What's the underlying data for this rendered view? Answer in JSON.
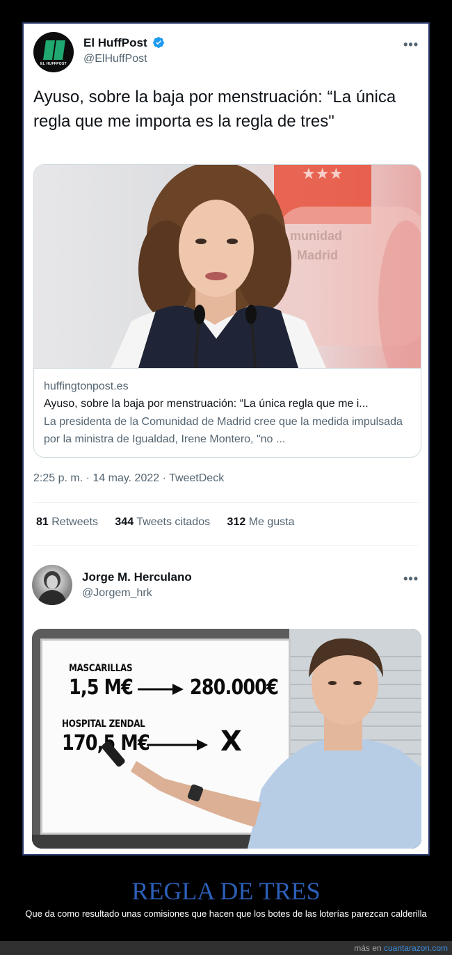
{
  "tweet": {
    "author_name": "El HuffPost",
    "author_handle": "@ElHuffPost",
    "avatar_text": "EL HUFFPOST",
    "more_label": "•••",
    "text": "Ayuso, sobre la baja por menstruación: “La única regla que me importa es la regla de tres\"",
    "card": {
      "domain": "huffingtonpost.es",
      "title": "Ayuso, sobre la baja por menstruación: “La única regla que me i...",
      "description": "La presidenta de la Comunidad de Madrid cree que la medida impulsada por la ministra de Igualdad, Irene Montero, \"no ...",
      "background_sign": "Comunidad de Madrid"
    },
    "timestamp": "2:25 p. m. · 14 may. 2022 · TweetDeck",
    "stats": {
      "retweets_count": "81",
      "retweets_label": "Retweets",
      "quotes_count": "344",
      "quotes_label": "Tweets citados",
      "likes_count": "312",
      "likes_label": "Me gusta"
    }
  },
  "reply": {
    "author_name": "Jorge M. Herculano",
    "author_handle": "@Jorgem_hrk",
    "more_label": "•••",
    "meme": {
      "line1_label": "MASCARILLAS",
      "line1_left": "1,5 M€",
      "line1_right": "280.000€",
      "line2_label": "HOSPITAL ZENDAL",
      "line2_left": "170,5 M€",
      "line2_right": "X"
    }
  },
  "post": {
    "title": "REGLA DE TRES",
    "subtitle": "Que da como resultado unas comisiones que hacen que los botes de las loterías parezcan calderilla"
  },
  "footer": {
    "prefix": "más en",
    "site": "cuantarazon.com"
  },
  "colors": {
    "title": "#2c5fb8",
    "link": "#3b8fe0",
    "verified": "#1d9bf0",
    "huffpost_green": "#1fa86f"
  }
}
